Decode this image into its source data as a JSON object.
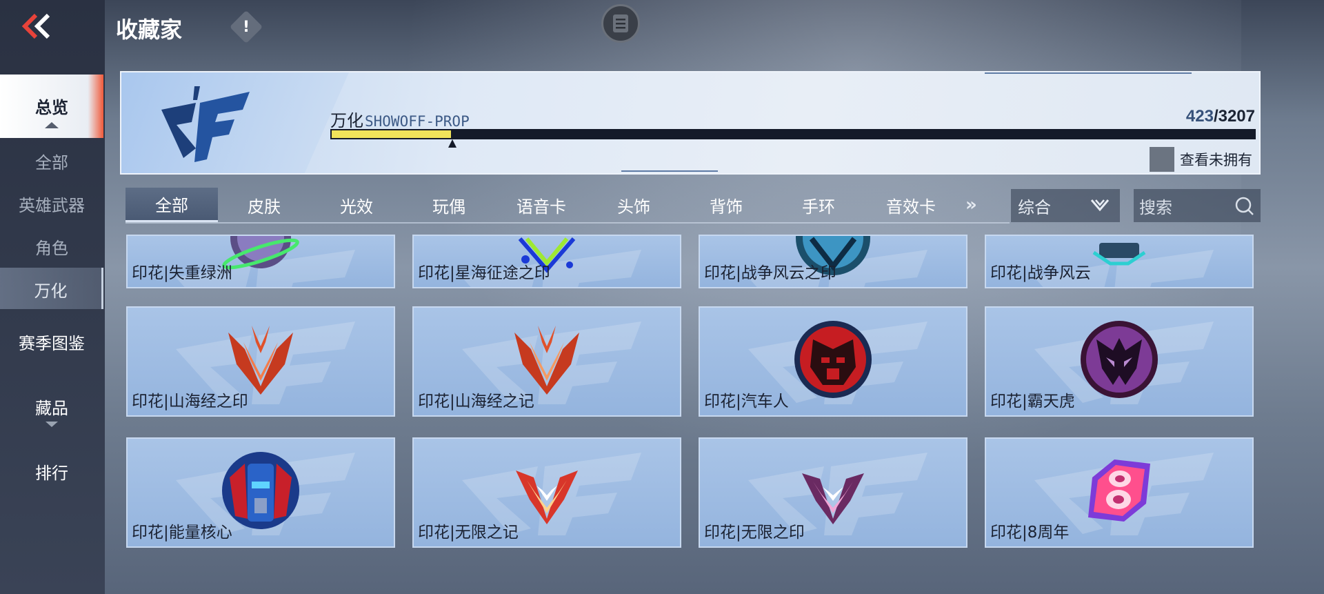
{
  "header": {
    "title": "收藏家",
    "info_icon": "!"
  },
  "sidebar": {
    "items": [
      {
        "label": "总览"
      },
      {
        "label": "全部"
      },
      {
        "label": "英雄武器"
      },
      {
        "label": "角色"
      },
      {
        "label": "万化"
      },
      {
        "label": "赛季图鉴"
      },
      {
        "label": "藏品"
      },
      {
        "label": "排行"
      }
    ]
  },
  "banner": {
    "name": "万化",
    "subname": "SHOWOFF-PROP",
    "owned": "423",
    "total": "/3207",
    "progress_fraction": 0.132,
    "toggle_label": "查看未拥有"
  },
  "tabs": [
    {
      "label": "全部"
    },
    {
      "label": "皮肤"
    },
    {
      "label": "光效"
    },
    {
      "label": "玩偶"
    },
    {
      "label": "语音卡"
    },
    {
      "label": "头饰"
    },
    {
      "label": "背饰"
    },
    {
      "label": "手环"
    },
    {
      "label": "音效卡"
    }
  ],
  "more_tabs": "»",
  "sort": {
    "value": "综合"
  },
  "search": {
    "placeholder": "搜索"
  },
  "items": [
    {
      "label": "印花|失重绿洲",
      "icon": "planet-ring-icon"
    },
    {
      "label": "印花|星海征途之印",
      "icon": "star-route-icon"
    },
    {
      "label": "印花|战争风云之印",
      "icon": "war-seal-icon"
    },
    {
      "label": "印花|战争风云",
      "icon": "war-drone-icon"
    },
    {
      "label": "印花|山海经之印",
      "icon": "shanhai-emblem-icon"
    },
    {
      "label": "印花|山海经之记",
      "icon": "shanhai-emblem-icon"
    },
    {
      "label": "印花|汽车人",
      "icon": "autobot-icon"
    },
    {
      "label": "印花|霸天虎",
      "icon": "decepticon-icon"
    },
    {
      "label": "印花|能量核心",
      "icon": "optimus-icon"
    },
    {
      "label": "印花|无限之记",
      "icon": "infinity-emblem-icon"
    },
    {
      "label": "印花|无限之印",
      "icon": "infinity-emblem-icon"
    },
    {
      "label": "印花|8周年",
      "icon": "eighth-anniversary-icon"
    }
  ]
}
